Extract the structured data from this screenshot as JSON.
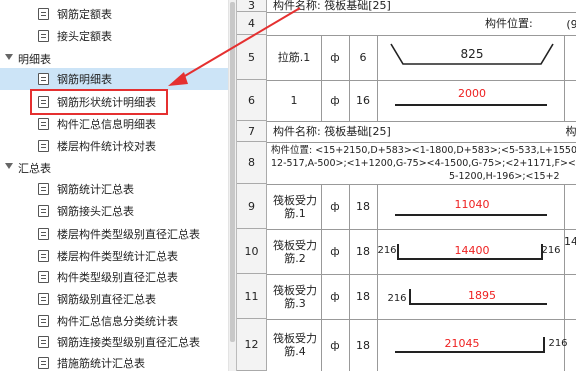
{
  "tree": {
    "items_top": [
      {
        "label": "钢筋定额表"
      },
      {
        "label": "接头定额表"
      }
    ],
    "group1": {
      "label": "明细表"
    },
    "group1_items": [
      {
        "label": "钢筋明细表"
      },
      {
        "label": "钢筋形状统计明细表"
      },
      {
        "label": "构件汇总信息明细表"
      },
      {
        "label": "楼层构件统计校对表"
      }
    ],
    "group2": {
      "label": "汇总表"
    },
    "group2_items": [
      {
        "label": "钢筋统计汇总表"
      },
      {
        "label": "钢筋接头汇总表"
      },
      {
        "label": "楼层构件类型级别直径汇总表"
      },
      {
        "label": "楼层构件类型统计汇总表"
      },
      {
        "label": "构件类型级别直径汇总表"
      },
      {
        "label": "钢筋级别直径汇总表"
      },
      {
        "label": "构件汇总信息分类统计表"
      },
      {
        "label": "钢筋连接类型级别直径汇总表"
      },
      {
        "label": "措施筋统计汇总表"
      }
    ]
  },
  "sheet": {
    "rows": {
      "r3": {
        "num": "3",
        "text": "构件名称: 筏板基础[25]"
      },
      "r4": {
        "num": "4",
        "pos": "构件位置:"
      },
      "r5": {
        "num": "5",
        "name": "拉筋.1",
        "grade": "ф",
        "dia": "6",
        "len": "825",
        "right": "(9"
      },
      "r6": {
        "num": "6",
        "name": "1",
        "grade": "ф",
        "dia": "16",
        "len": "2000"
      },
      "r7": {
        "num": "7",
        "text": "构件名称: 筏板基础[25]",
        "right": "构"
      },
      "r8": {
        "num": "8",
        "line1": "构件位置: <15+2150,D+583><1-1800,D+583>;<5-533,L+1550><6+1",
        "line2": "12-517,A-500>;<1+1200,G-75><4-1500,G-75>;<2+1171,F><2+11",
        "line3": "5-1200,H-196>;<15+2"
      },
      "r9": {
        "num": "9",
        "name": "筏板受力筋.1",
        "grade": "ф",
        "dia": "18",
        "len": "11040"
      },
      "r10": {
        "num": "10",
        "name": "筏板受力筋.2",
        "grade": "ф",
        "dia": "18",
        "len": "14400",
        "hook_l": "216",
        "hook_r": "216",
        "right": "14"
      },
      "r11": {
        "num": "11",
        "name": "筏板受力筋.3",
        "grade": "ф",
        "dia": "18",
        "len": "1895",
        "hook_l": "216"
      },
      "r12": {
        "num": "12",
        "name": "筏板受力筋.4",
        "grade": "ф",
        "dia": "18",
        "len": "21045",
        "hook_r": "216"
      }
    }
  },
  "colors": {
    "highlight": "#e53030",
    "selected": "#cce4f7",
    "value_red": "#e22"
  }
}
